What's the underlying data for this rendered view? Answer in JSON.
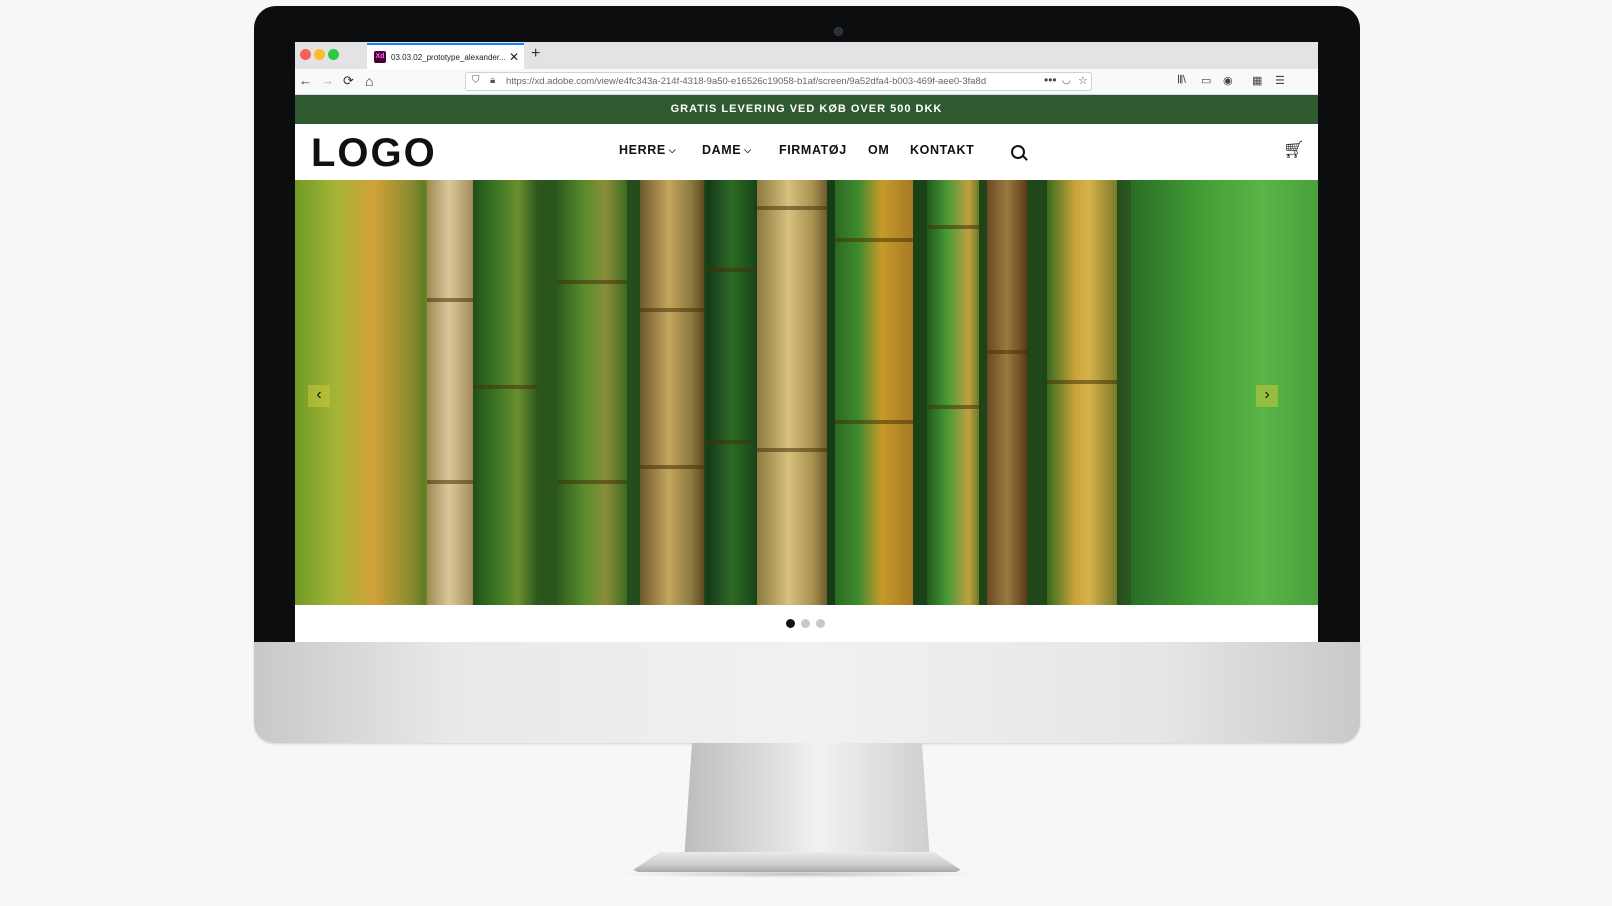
{
  "browser": {
    "tab_title": "03.03.02_prototype_alexander...",
    "favicon_text": "Xd",
    "new_tab": "+",
    "close": "✕",
    "url": "https://xd.adobe.com/view/e4fc343a-214f-4318-9a50-e16526c19058-b1af/screen/9a52dfa4-b003-469f-aee0-3fa8d",
    "back": "←",
    "forward": "→",
    "reload": "⟳",
    "home": "⌂",
    "more": "•••"
  },
  "promo_bar": {
    "text": "GRATIS LEVERING VED KØB OVER 500 DKK",
    "color": "#2f5a2f"
  },
  "header": {
    "logo": "LOGO",
    "menu": [
      {
        "label": "HERRE",
        "dropdown": true
      },
      {
        "label": "DAME",
        "dropdown": true
      },
      {
        "label": "FIRMATØJ",
        "dropdown": false
      },
      {
        "label": "OM",
        "dropdown": false
      },
      {
        "label": "KONTAKT",
        "dropdown": false
      }
    ],
    "chevron": "⌵",
    "search_icon": "search-icon",
    "cart_icon": "cart-icon"
  },
  "hero": {
    "image": "bamboo-forest",
    "prev": "‹",
    "next": "›"
  },
  "carousel": {
    "slides": 3,
    "active": 1
  }
}
